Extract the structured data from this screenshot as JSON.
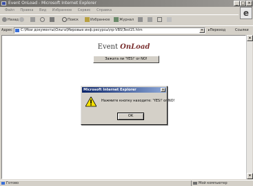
{
  "window": {
    "title": "Event OnLoad - Microsoft Internet Explorer"
  },
  "menu": {
    "items": [
      "Файл",
      "Правка",
      "Вид",
      "Избранное",
      "Сервис",
      "Справка"
    ]
  },
  "toolbar": {
    "back": "Назад",
    "search": "Поиск",
    "favorites": "Избранное",
    "history": "Журнал"
  },
  "address": {
    "label": "Адрес",
    "value": "C:\\Мои документы\\Ольга\\Мировые инф.ресурсы\\пр-VBS\\Test15.htm",
    "go": "Переход",
    "links": "Ссылки"
  },
  "page": {
    "heading_prefix": "Event",
    "heading_emphasis": "OnLoad",
    "button_label": "Зажата ли 'YES!' or NO!"
  },
  "dialog": {
    "title": "Microsoft Internet Explorer",
    "icon": "warning-icon",
    "message": "Нажмите кнопку находите: 'YES!' or NO!",
    "ok_label": "OK"
  },
  "status": {
    "left": "Готово",
    "right": "Мой компьютер"
  },
  "colors": {
    "dialog_title_start": "#0a246a",
    "dialog_title_end": "#8da8d8",
    "heading_accent": "#7a3030"
  }
}
